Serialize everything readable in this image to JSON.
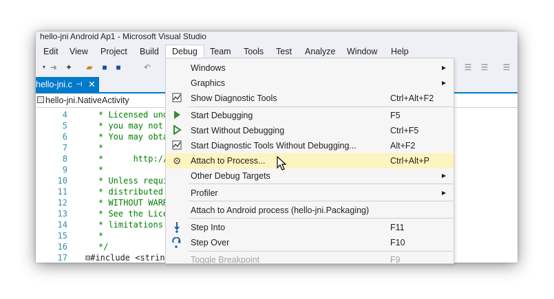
{
  "window": {
    "title": "hello-jni Android Ap1 - Microsoft Visual Studio"
  },
  "menu": {
    "items": [
      "Edit",
      "View",
      "Project",
      "Build",
      "Debug",
      "Team",
      "Tools",
      "Test",
      "Analyze",
      "Window",
      "Help"
    ],
    "active": "Debug"
  },
  "tab": {
    "label": "hello-jni.c",
    "pin": "⊣",
    "close": "✕"
  },
  "navbar": {
    "scope": "hello-jni.NativeActivity"
  },
  "editor": {
    "lines": [
      {
        "n": "4",
        "text": "* Licensed und"
      },
      {
        "n": "5",
        "text": "* you may not "
      },
      {
        "n": "6",
        "text": "* You may obta"
      },
      {
        "n": "7",
        "text": "*"
      },
      {
        "n": "8",
        "text": "*      http://"
      },
      {
        "n": "9",
        "text": "*"
      },
      {
        "n": "10",
        "text": "* Unless requi"
      },
      {
        "n": "11",
        "text": "* distributed "
      },
      {
        "n": "12",
        "text": "* WITHOUT WARR"
      },
      {
        "n": "13",
        "text": "* See the Lice"
      },
      {
        "n": "14",
        "text": "* limitations "
      },
      {
        "n": "15",
        "text": "*"
      },
      {
        "n": "16",
        "text": "*/"
      },
      {
        "n": "17",
        "text": "⊟#include <strin"
      }
    ]
  },
  "debug_menu": {
    "items": [
      {
        "label": "Windows",
        "shortcut": "",
        "submenu": true,
        "icon": ""
      },
      {
        "label": "Graphics",
        "shortcut": "",
        "submenu": true,
        "icon": ""
      },
      {
        "label": "Show Diagnostic Tools",
        "shortcut": "Ctrl+Alt+F2",
        "submenu": false,
        "icon": "diagnostic-icon"
      },
      {
        "label": "Start Debugging",
        "shortcut": "F5",
        "submenu": false,
        "icon": "play-icon"
      },
      {
        "label": "Start Without Debugging",
        "shortcut": "Ctrl+F5",
        "submenu": false,
        "icon": "play-outline-icon"
      },
      {
        "label": "Start Diagnostic Tools Without Debugging...",
        "shortcut": "Alt+F2",
        "submenu": false,
        "icon": "diagnostic-icon"
      },
      {
        "label": "Attach to Process...",
        "shortcut": "Ctrl+Alt+P",
        "submenu": false,
        "icon": "gears-icon",
        "highlighted": true
      },
      {
        "label": "Other Debug Targets",
        "shortcut": "",
        "submenu": true,
        "icon": ""
      },
      {
        "label": "Profiler",
        "shortcut": "",
        "submenu": true,
        "icon": ""
      },
      {
        "label": "Attach to Android process (hello-jni.Packaging)",
        "shortcut": "",
        "submenu": false,
        "icon": ""
      },
      {
        "label": "Step Into",
        "shortcut": "F11",
        "submenu": false,
        "icon": "step-into-icon"
      },
      {
        "label": "Step Over",
        "shortcut": "F10",
        "submenu": false,
        "icon": "step-over-icon"
      },
      {
        "label": "Toggle Breakpoint",
        "shortcut": "F9",
        "submenu": false,
        "icon": "",
        "disabled": true
      }
    ]
  },
  "colors": {
    "accent": "#007acc",
    "highlight": "#fdf4bf",
    "comment": "#008000",
    "line_number": "#2b91af",
    "play": "#388a34"
  }
}
